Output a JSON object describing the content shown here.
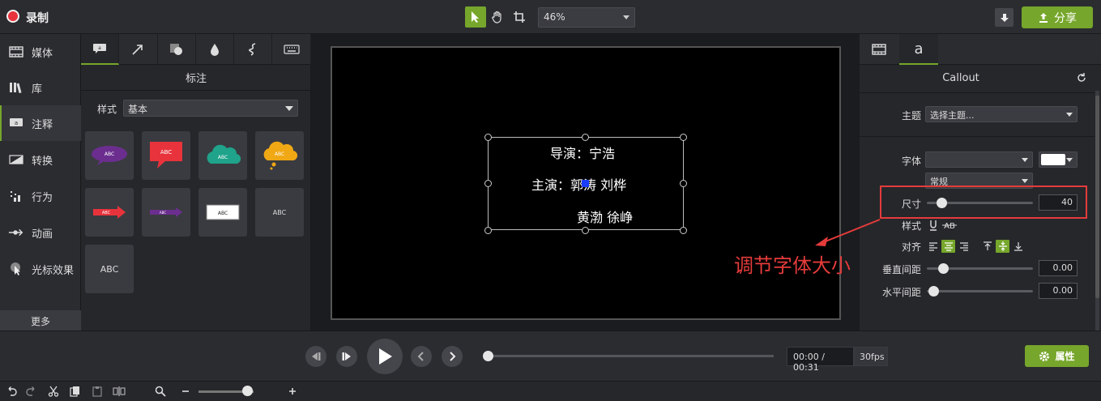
{
  "topbar": {
    "record_label": "录制",
    "zoom_value": "46%",
    "share_label": "分享"
  },
  "leftnav": {
    "items": [
      {
        "label": "媒体",
        "icon": "film-icon"
      },
      {
        "label": "库",
        "icon": "library-icon"
      },
      {
        "label": "注释",
        "icon": "annotation-icon"
      },
      {
        "label": "转换",
        "icon": "transition-icon"
      },
      {
        "label": "行为",
        "icon": "behavior-icon"
      },
      {
        "label": "动画",
        "icon": "animation-icon"
      },
      {
        "label": "光标效果",
        "icon": "cursor-effect-icon"
      }
    ],
    "more_label": "更多"
  },
  "annotations": {
    "title": "标注",
    "style_label": "样式",
    "style_value": "基本",
    "tiles": [
      {
        "label": "ABC",
        "shape": "speech-oval",
        "color": "#6b2e8f"
      },
      {
        "label": "ABC",
        "shape": "speech-rect",
        "color": "#e8333c"
      },
      {
        "label": "ABC",
        "shape": "cloud",
        "color": "#1fa38a"
      },
      {
        "label": "ABC",
        "shape": "thought-cloud",
        "color": "#f0a815"
      },
      {
        "label": "ABC",
        "shape": "arrow",
        "color": "#e8333c"
      },
      {
        "label": "ABC",
        "shape": "arrow",
        "color": "#6b2e8f"
      },
      {
        "label": "ABC",
        "shape": "rect",
        "color": "#ffffff"
      },
      {
        "label": "ABC",
        "shape": "text",
        "color": "#d8d8d8"
      },
      {
        "label": "ABC",
        "shape": "text-large",
        "color": "#d8d8d8"
      }
    ]
  },
  "canvas": {
    "lines": [
      "导演：宁浩",
      "主演：郭涛 刘桦",
      "黄渤 徐峥"
    ]
  },
  "properties": {
    "title": "Callout",
    "theme_label": "主题",
    "theme_value": "选择主题...",
    "font_label": "字体",
    "font_value": "",
    "font_color": "#ffffff",
    "weight_value": "常规",
    "size_label": "尺寸",
    "size_value": "40",
    "style_label": "样式",
    "align_label": "对齐",
    "line_spacing_label": "垂直间距",
    "line_spacing_value": "0.00",
    "char_spacing_label": "水平间距",
    "char_spacing_value": "0.00"
  },
  "annotation_overlay": "调节字体大小",
  "playback": {
    "time": "00:00 / 00:31",
    "fps": "30fps",
    "props_label": "属性"
  },
  "colors": {
    "accent": "#76a62b",
    "highlight": "#e53b3b"
  }
}
